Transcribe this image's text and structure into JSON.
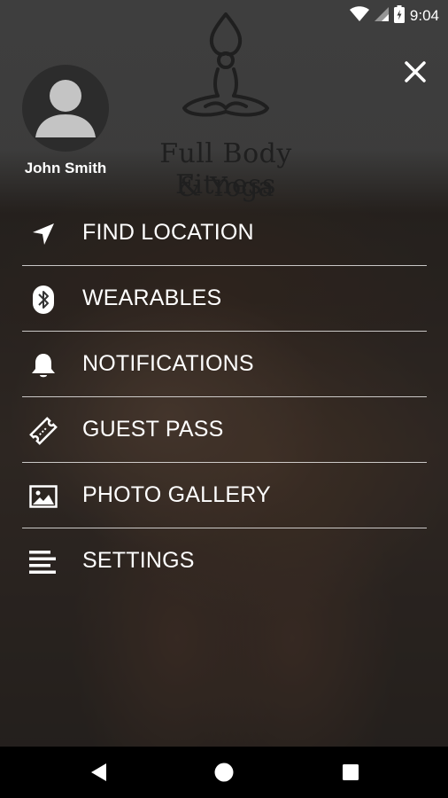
{
  "status_bar": {
    "time": "9:04"
  },
  "logo": {
    "line1": "Full Body Fitness",
    "line2": "& Yoga"
  },
  "profile": {
    "name": "John Smith"
  },
  "menu": {
    "items": [
      {
        "label": "FIND LOCATION",
        "icon": "navigation-arrow-icon"
      },
      {
        "label": "WEARABLES",
        "icon": "bluetooth-icon"
      },
      {
        "label": "NOTIFICATIONS",
        "icon": "bell-icon"
      },
      {
        "label": "GUEST PASS",
        "icon": "ticket-icon"
      },
      {
        "label": "PHOTO GALLERY",
        "icon": "photo-icon"
      },
      {
        "label": "SETTINGS",
        "icon": "settings-lines-icon"
      }
    ]
  },
  "colors": {
    "divider": "#ffffff",
    "nav_bar": "#000000",
    "logo_text": "#1f1f1f"
  }
}
